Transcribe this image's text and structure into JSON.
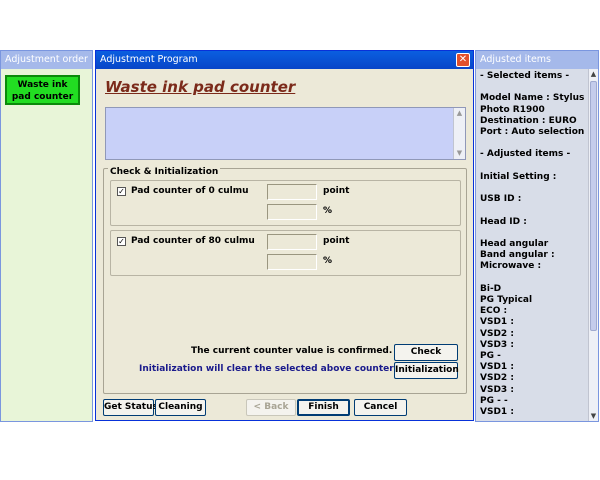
{
  "left_panel": {
    "title": "Adjustment order",
    "item_label": "Waste ink pad counter"
  },
  "main_window": {
    "title": "Adjustment Program",
    "close_glyph": "✕",
    "heading": "Waste ink pad counter",
    "group_title": "Check & Initialization",
    "counter1": {
      "checked": true,
      "label": "Pad counter of  0 culmu",
      "point_value": "",
      "percent_value": "",
      "point_unit": "point",
      "percent_unit": "%"
    },
    "counter2": {
      "checked": true,
      "label": "Pad counter of 80 culmu",
      "point_value": "",
      "percent_value": "",
      "point_unit": "point",
      "percent_unit": "%"
    },
    "confirm_text": "The current counter value is confirmed. -->",
    "init_text": "Initialization will clear the selected above counters. -->",
    "check_button": "Check",
    "init_button": "Initialization",
    "buttons": {
      "get_status": "Get Status",
      "cleaning": "Cleaning",
      "back": "< Back",
      "finish": "Finish",
      "cancel": "Cancel"
    }
  },
  "right_panel": {
    "title": "Adjusted items",
    "lines": [
      "- Selected items -",
      "",
      "Model Name : Stylus",
      "Photo R1900",
      "Destination : EURO",
      "Port : Auto selection",
      "",
      "- Adjusted items -",
      "",
      "Initial Setting :",
      "",
      "USB ID :",
      "",
      "Head ID :",
      "",
      "Head angular",
      "Band angular :",
      "Microwave :",
      "",
      "Bi-D",
      "PG Typical",
      "  ECO   :",
      "  VSD1 :",
      "  VSD2 :",
      "  VSD3 :",
      "PG -",
      "  VSD1 :",
      "  VSD2 :",
      "  VSD3 :",
      "PG - -",
      "  VSD1 :"
    ]
  },
  "colors": {
    "title_bar": "#0845c8",
    "heading": "#7b2a1a",
    "selected_item": "#22dd22",
    "message_area": "#c8d0f8",
    "init_text": "#1a1a8c"
  },
  "icons": {
    "close": "close-icon",
    "checkbox": "checkmark-icon",
    "scroll_up": "arrow-up-icon",
    "scroll_down": "arrow-down-icon"
  }
}
